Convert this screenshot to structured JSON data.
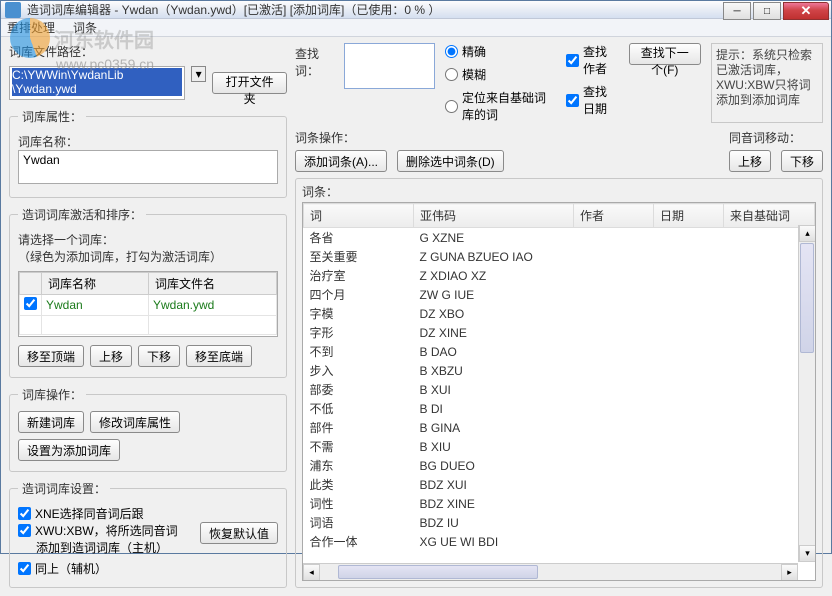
{
  "window": {
    "title": "造词词库编辑器 - Ywdan（Ywdan.ywd）[已激活] [添加词库]（已使用：0 % ）"
  },
  "menu": {
    "queue": "重排处理",
    "entry": "词条"
  },
  "watermark": {
    "text": "河东软件园",
    "url": "www.pc0359.cn"
  },
  "left": {
    "path_label": "词库文件路径：",
    "path_line1": "C:\\YWWin\\YwdanLib",
    "path_line2": "\\Ywdan.ywd",
    "open_folder": "打开文件夹",
    "attrs_legend": "词库属性：",
    "name_label": "词库名称：",
    "name_value": "Ywdan",
    "activate_legend": "造词词库激活和排序：",
    "select_hint": "请选择一个词库：",
    "select_sub": "（绿色为添加词库，打勾为激活词库）",
    "grid": {
      "col_name": "词库名称",
      "col_file": "词库文件名",
      "row_name": "Ywdan",
      "row_file": "Ywdan.ywd"
    },
    "mv_top": "移至顶端",
    "mv_up": "上移",
    "mv_down": "下移",
    "mv_bottom": "移至底端",
    "ops_legend": "词库操作：",
    "new_db": "新建词库",
    "edit_attr": "修改词库属性",
    "set_add": "设置为添加词库",
    "settings_legend": "造词词库设置：",
    "chk1": "XNE选择同音词后跟",
    "chk2a": "XWU:XBW，将所选同音词",
    "chk2b": "添加到造词词库（主机）",
    "chk3": "同上（辅机）",
    "restore": "恢复默认值"
  },
  "right": {
    "search_label": "查找词：",
    "r_exact": "精确",
    "r_fuzzy": "模糊",
    "r_base": "定位来自基础词库的词",
    "chk_author": "查找作者",
    "chk_date": "查找日期",
    "find_next": "查找下一个(F)",
    "hint": "提示：系统只检索已激活词库，XWU:XBW只将词添加到添加词库",
    "entry_ops_label": "词条操作：",
    "add_entry": "添加词条(A)...",
    "del_entry": "删除选中词条(D)",
    "syn_move_label": "同音词移动：",
    "syn_up": "上移",
    "syn_down": "下移",
    "entries_label": "词条：",
    "cols": {
      "word": "词",
      "code": "亚伟码",
      "author": "作者",
      "date": "日期",
      "base": "来自基础词"
    },
    "rows": [
      {
        "w": "各省",
        "c": "G XZNE"
      },
      {
        "w": "至关重要",
        "c": "Z GUNA BZUEO IAO"
      },
      {
        "w": "治疗室",
        "c": "Z XDIAO XZ"
      },
      {
        "w": "四个月",
        "c": "ZW G IUE"
      },
      {
        "w": "字模",
        "c": "DZ XBO"
      },
      {
        "w": "字形",
        "c": "DZ XINE"
      },
      {
        "w": "不到",
        "c": "B DAO"
      },
      {
        "w": "步入",
        "c": "B XBZU"
      },
      {
        "w": "部委",
        "c": "B XUI"
      },
      {
        "w": "不低",
        "c": "B DI"
      },
      {
        "w": "部件",
        "c": "B GINA"
      },
      {
        "w": "不需",
        "c": "B XIU"
      },
      {
        "w": "浦东",
        "c": "BG DUEO"
      },
      {
        "w": "此类",
        "c": "BDZ XUI"
      },
      {
        "w": "词性",
        "c": "BDZ XINE"
      },
      {
        "w": "词语",
        "c": "BDZ IU"
      },
      {
        "w": "合作一体",
        "c": "XG UE WI BDI"
      }
    ]
  }
}
